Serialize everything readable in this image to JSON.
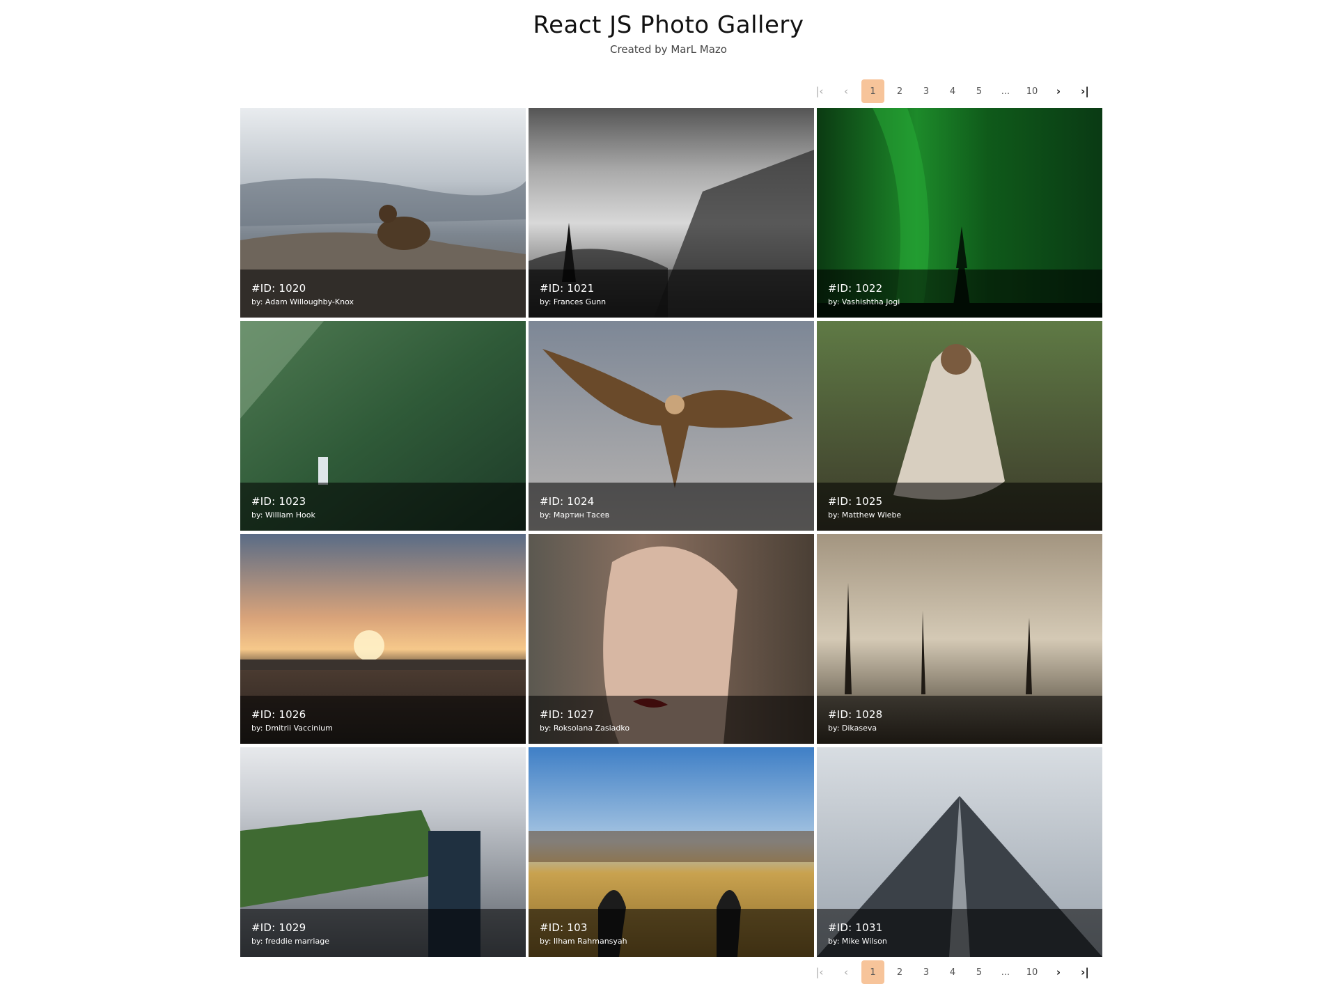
{
  "header": {
    "title": "React JS Photo Gallery",
    "subtitle": "Created by MarL Mazo"
  },
  "pagination": {
    "first_icon": "first-page-icon",
    "prev_icon": "previous-page-icon",
    "next_icon": "next-page-icon",
    "last_icon": "last-page-icon",
    "pages": [
      "1",
      "2",
      "3",
      "4",
      "5",
      "...",
      "10"
    ],
    "current_page": "1",
    "active_color": "#f7c49a"
  },
  "photos": [
    {
      "id_label": "#ID: 1020",
      "author": "by: Adam Willoughby-Knox"
    },
    {
      "id_label": "#ID: 1021",
      "author": "by: Frances Gunn"
    },
    {
      "id_label": "#ID: 1022",
      "author": "by: Vashishtha Jogi"
    },
    {
      "id_label": "#ID: 1023",
      "author": "by: William Hook"
    },
    {
      "id_label": "#ID: 1024",
      "author": "by: Мартин Тасев"
    },
    {
      "id_label": "#ID: 1025",
      "author": "by: Matthew Wiebe"
    },
    {
      "id_label": "#ID: 1026",
      "author": "by: Dmitrii Vaccinium"
    },
    {
      "id_label": "#ID: 1027",
      "author": "by: Roksolana Zasiadko"
    },
    {
      "id_label": "#ID: 1028",
      "author": "by: Dikaseva"
    },
    {
      "id_label": "#ID: 1029",
      "author": "by: freddie marriage"
    },
    {
      "id_label": "#ID: 103",
      "author": "by: Ilham Rahmansyah"
    },
    {
      "id_label": "#ID: 1031",
      "author": "by: Mike Wilson"
    }
  ]
}
